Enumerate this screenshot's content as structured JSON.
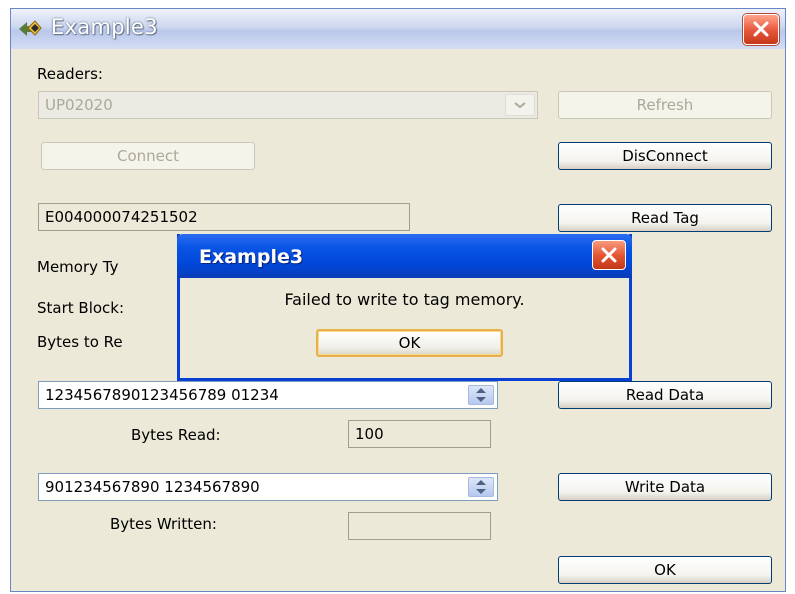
{
  "window": {
    "title": "Example3"
  },
  "readers": {
    "label": "Readers:",
    "selected": "UP02020",
    "refresh_label": "Refresh",
    "connect_label": "Connect",
    "disconnect_label": "DisConnect"
  },
  "tag": {
    "id": "E004000074251502",
    "read_tag_label": "Read Tag"
  },
  "labels": {
    "memory_type": "Memory Ty",
    "start_block": "Start Block:",
    "bytes_to_read": "Bytes to Re",
    "bytes_read": "Bytes Read:",
    "bytes_written": "Bytes Written:"
  },
  "read": {
    "data": "1234567890123456789 01234",
    "read_data_label": "Read Data",
    "bytes_read_value": "100"
  },
  "write": {
    "data": "901234567890 1234567890",
    "write_data_label": "Write Data",
    "bytes_written_value": ""
  },
  "ok_label": "OK",
  "message_box": {
    "title": "Example3",
    "message": "Failed to write to tag memory.",
    "ok_label": "OK"
  },
  "colors": {
    "window_bg": "#ece9d8",
    "dialog_title": "#0a55e6",
    "close_button": "#e3522e"
  }
}
